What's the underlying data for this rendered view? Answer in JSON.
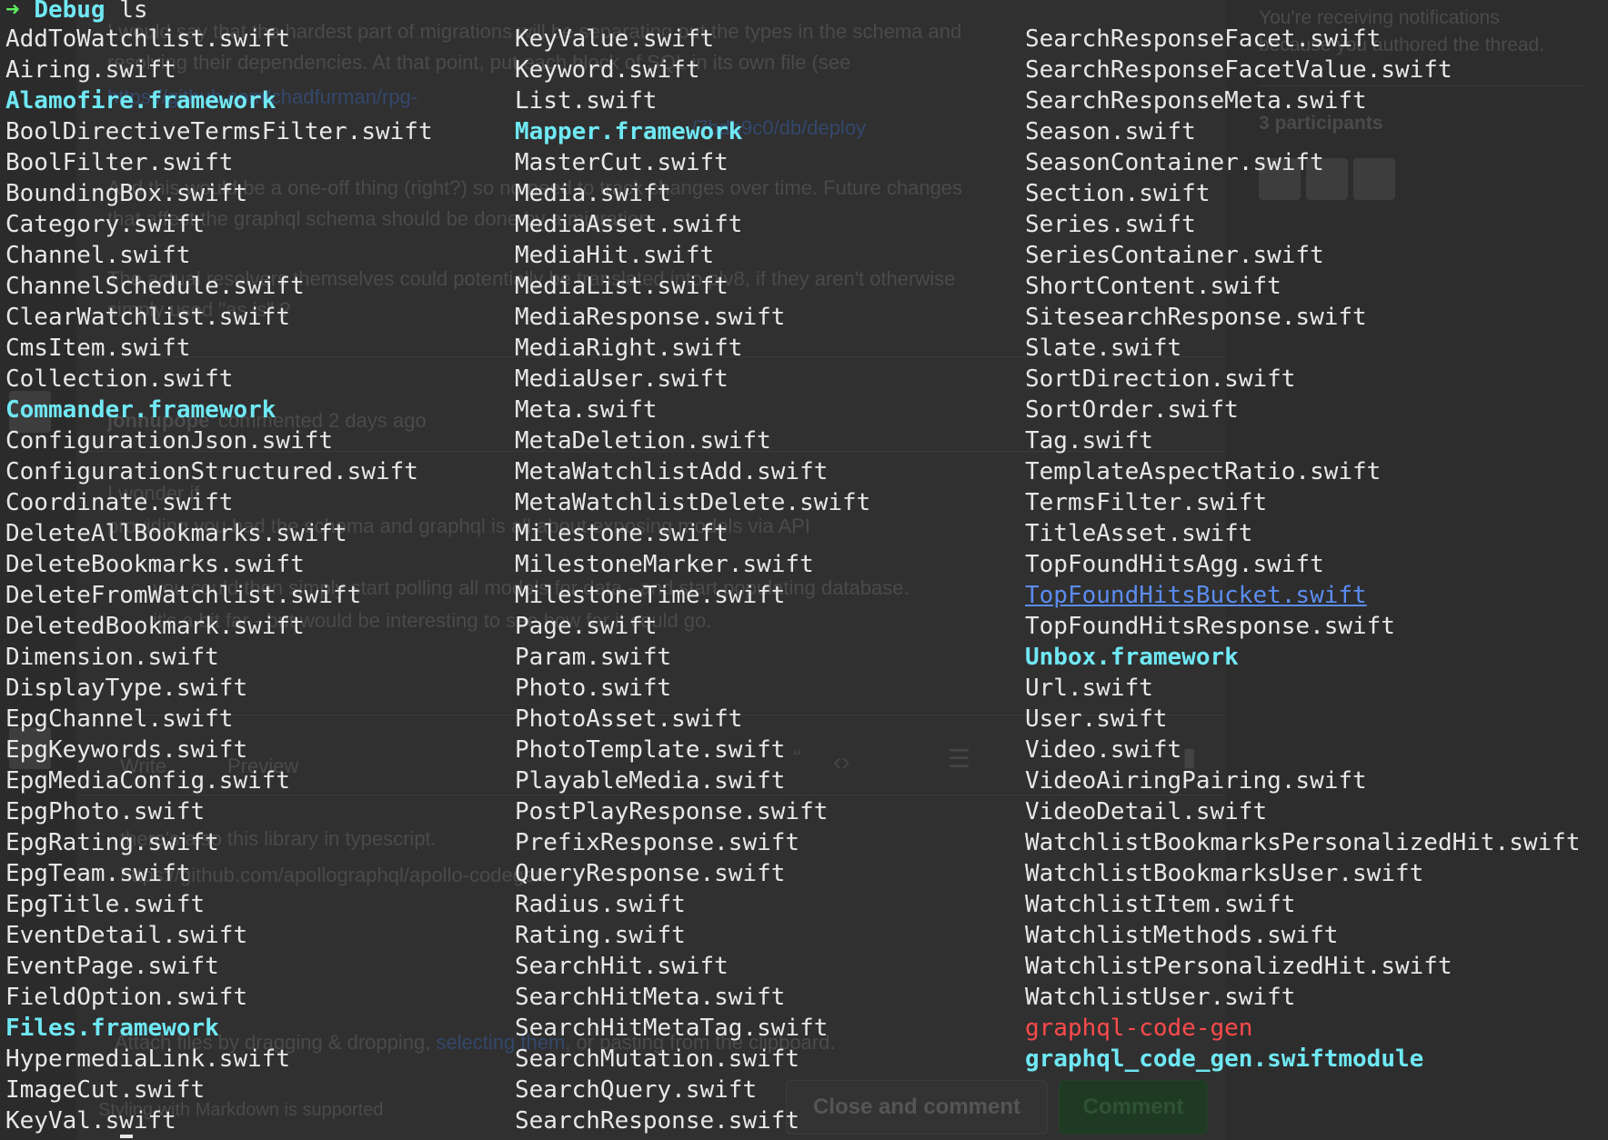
{
  "terminal": {
    "prompt_arrow": "➜",
    "prompt_dir": "Debug",
    "command": "ls",
    "columns": [
      [
        {
          "name": "AddToWatchlist.swift",
          "kind": "file"
        },
        {
          "name": "Airing.swift",
          "kind": "file"
        },
        {
          "name": "Alamofire.framework",
          "kind": "dir"
        },
        {
          "name": "BoolDirectiveTermsFilter.swift",
          "kind": "file"
        },
        {
          "name": "BoolFilter.swift",
          "kind": "file"
        },
        {
          "name": "BoundingBox.swift",
          "kind": "file"
        },
        {
          "name": "Category.swift",
          "kind": "file"
        },
        {
          "name": "Channel.swift",
          "kind": "file"
        },
        {
          "name": "ChannelSchedule.swift",
          "kind": "file"
        },
        {
          "name": "ClearWatchlist.swift",
          "kind": "file"
        },
        {
          "name": "CmsItem.swift",
          "kind": "file"
        },
        {
          "name": "Collection.swift",
          "kind": "file"
        },
        {
          "name": "Commander.framework",
          "kind": "dir"
        },
        {
          "name": "ConfigurationJson.swift",
          "kind": "file"
        },
        {
          "name": "ConfigurationStructured.swift",
          "kind": "file"
        },
        {
          "name": "Coordinate.swift",
          "kind": "file"
        },
        {
          "name": "DeleteAllBookmarks.swift",
          "kind": "file"
        },
        {
          "name": "DeleteBookmarks.swift",
          "kind": "file"
        },
        {
          "name": "DeleteFromWatchlist.swift",
          "kind": "file"
        },
        {
          "name": "DeletedBookmark.swift",
          "kind": "file"
        },
        {
          "name": "Dimension.swift",
          "kind": "file"
        },
        {
          "name": "DisplayType.swift",
          "kind": "file"
        },
        {
          "name": "EpgChannel.swift",
          "kind": "file"
        },
        {
          "name": "EpgKeywords.swift",
          "kind": "file"
        },
        {
          "name": "EpgMediaConfig.swift",
          "kind": "file"
        },
        {
          "name": "EpgPhoto.swift",
          "kind": "file"
        },
        {
          "name": "EpgRating.swift",
          "kind": "file"
        },
        {
          "name": "EpgTeam.swift",
          "kind": "file"
        },
        {
          "name": "EpgTitle.swift",
          "kind": "file"
        },
        {
          "name": "EventDetail.swift",
          "kind": "file"
        },
        {
          "name": "EventPage.swift",
          "kind": "file"
        },
        {
          "name": "FieldOption.swift",
          "kind": "file"
        },
        {
          "name": "Files.framework",
          "kind": "dir"
        },
        {
          "name": "HypermediaLink.swift",
          "kind": "file"
        },
        {
          "name": "ImageCut.swift",
          "kind": "file"
        },
        {
          "name": "KeyVal.swift",
          "kind": "file"
        }
      ],
      [
        {
          "name": "KeyValue.swift",
          "kind": "file"
        },
        {
          "name": "Keyword.swift",
          "kind": "file"
        },
        {
          "name": "List.swift",
          "kind": "file"
        },
        {
          "name": "Mapper.framework",
          "kind": "dir"
        },
        {
          "name": "MasterCut.swift",
          "kind": "file"
        },
        {
          "name": "Media.swift",
          "kind": "file"
        },
        {
          "name": "MediaAsset.swift",
          "kind": "file"
        },
        {
          "name": "MediaHit.swift",
          "kind": "file"
        },
        {
          "name": "MediaList.swift",
          "kind": "file"
        },
        {
          "name": "MediaResponse.swift",
          "kind": "file"
        },
        {
          "name": "MediaRight.swift",
          "kind": "file"
        },
        {
          "name": "MediaUser.swift",
          "kind": "file"
        },
        {
          "name": "Meta.swift",
          "kind": "file"
        },
        {
          "name": "MetaDeletion.swift",
          "kind": "file"
        },
        {
          "name": "MetaWatchlistAdd.swift",
          "kind": "file"
        },
        {
          "name": "MetaWatchlistDelete.swift",
          "kind": "file"
        },
        {
          "name": "Milestone.swift",
          "kind": "file"
        },
        {
          "name": "MilestoneMarker.swift",
          "kind": "file"
        },
        {
          "name": "MilestoneTime.swift",
          "kind": "file"
        },
        {
          "name": "Page.swift",
          "kind": "file"
        },
        {
          "name": "Param.swift",
          "kind": "file"
        },
        {
          "name": "Photo.swift",
          "kind": "file"
        },
        {
          "name": "PhotoAsset.swift",
          "kind": "file"
        },
        {
          "name": "PhotoTemplate.swift",
          "kind": "file"
        },
        {
          "name": "PlayableMedia.swift",
          "kind": "file"
        },
        {
          "name": "PostPlayResponse.swift",
          "kind": "file"
        },
        {
          "name": "PrefixResponse.swift",
          "kind": "file"
        },
        {
          "name": "QueryResponse.swift",
          "kind": "file"
        },
        {
          "name": "Radius.swift",
          "kind": "file"
        },
        {
          "name": "Rating.swift",
          "kind": "file"
        },
        {
          "name": "SearchHit.swift",
          "kind": "file"
        },
        {
          "name": "SearchHitMeta.swift",
          "kind": "file"
        },
        {
          "name": "SearchHitMetaTag.swift",
          "kind": "file"
        },
        {
          "name": "SearchMutation.swift",
          "kind": "file"
        },
        {
          "name": "SearchQuery.swift",
          "kind": "file"
        },
        {
          "name": "SearchResponse.swift",
          "kind": "file"
        }
      ],
      [
        {
          "name": "SearchResponseFacet.swift",
          "kind": "file"
        },
        {
          "name": "SearchResponseFacetValue.swift",
          "kind": "file"
        },
        {
          "name": "SearchResponseMeta.swift",
          "kind": "file"
        },
        {
          "name": "Season.swift",
          "kind": "file"
        },
        {
          "name": "SeasonContainer.swift",
          "kind": "file"
        },
        {
          "name": "Section.swift",
          "kind": "file"
        },
        {
          "name": "Series.swift",
          "kind": "file"
        },
        {
          "name": "SeriesContainer.swift",
          "kind": "file"
        },
        {
          "name": "ShortContent.swift",
          "kind": "file"
        },
        {
          "name": "SitesearchResponse.swift",
          "kind": "file"
        },
        {
          "name": "Slate.swift",
          "kind": "file"
        },
        {
          "name": "SortDirection.swift",
          "kind": "file"
        },
        {
          "name": "SortOrder.swift",
          "kind": "file"
        },
        {
          "name": "Tag.swift",
          "kind": "file"
        },
        {
          "name": "TemplateAspectRatio.swift",
          "kind": "file"
        },
        {
          "name": "TermsFilter.swift",
          "kind": "file"
        },
        {
          "name": "TitleAsset.swift",
          "kind": "file"
        },
        {
          "name": "TopFoundHitsAgg.swift",
          "kind": "file"
        },
        {
          "name": "TopFoundHitsBucket.swift",
          "kind": "link"
        },
        {
          "name": "TopFoundHitsResponse.swift",
          "kind": "file"
        },
        {
          "name": "Unbox.framework",
          "kind": "dir"
        },
        {
          "name": "Url.swift",
          "kind": "file"
        },
        {
          "name": "User.swift",
          "kind": "file"
        },
        {
          "name": "Video.swift",
          "kind": "file"
        },
        {
          "name": "VideoAiringPairing.swift",
          "kind": "file"
        },
        {
          "name": "VideoDetail.swift",
          "kind": "file"
        },
        {
          "name": "WatchlistBookmarksPersonalizedHit.swift",
          "kind": "file"
        },
        {
          "name": "WatchlistBookmarksUser.swift",
          "kind": "file"
        },
        {
          "name": "WatchlistItem.swift",
          "kind": "file"
        },
        {
          "name": "WatchlistMethods.swift",
          "kind": "file"
        },
        {
          "name": "WatchlistPersonalizedHit.swift",
          "kind": "file"
        },
        {
          "name": "WatchlistUser.swift",
          "kind": "file"
        },
        {
          "name": "graphql-code-gen",
          "kind": "exec"
        },
        {
          "name": "graphql_code_gen.swiftmodule",
          "kind": "dir"
        }
      ]
    ]
  },
  "background_page": {
    "comment_text": [
      "I would say that the hardest part of migrations will be separating out the types in the schema and",
      "resolving their dependencies. At that point, put each block of SQL in its own file (see",
      "And this would be a one-off thing (right?) so no need to track changes over time. Future changes",
      "that affect the graphql schema should be done by a migration.",
      "The actual resolvers themselves could potentially be translated into plv8, if they aren't otherwise",
      "simply used \"as is\" ?"
    ],
    "comment_link_1": "https://github.com/chadfurman/rpg-",
    "comment_link_2": "/7bdb9c0/db/deploy",
    "commenter": "jonnupope",
    "commented_ago": "commented 2 days ago",
    "second_comment": [
      "I wonder if",
      "providing you had the schema and graphql is all about exposing models via API",
      "you could then simply start polling all models for data - and start populating database.",
      "it's a bit far - but would be interesting to see how far it could go."
    ],
    "editor_tabs": [
      "Write",
      "Preview"
    ],
    "editor_text": "there's also this library in typescript.",
    "editor_link": "https://github.com/apollographql/apollo-codegen",
    "attach_hint": "Attach files by dragging & dropping,",
    "attach_link": "selecting them",
    "attach_hint_end": ", or pasting from the clipboard.",
    "markdown_note": "Styling with Markdown is supported",
    "close_button": "Close and comment",
    "comment_button": "Comment",
    "notifications_line1": "You're receiving notifications",
    "notifications_line2": "because you authored the thread.",
    "participants": "3 participants"
  }
}
